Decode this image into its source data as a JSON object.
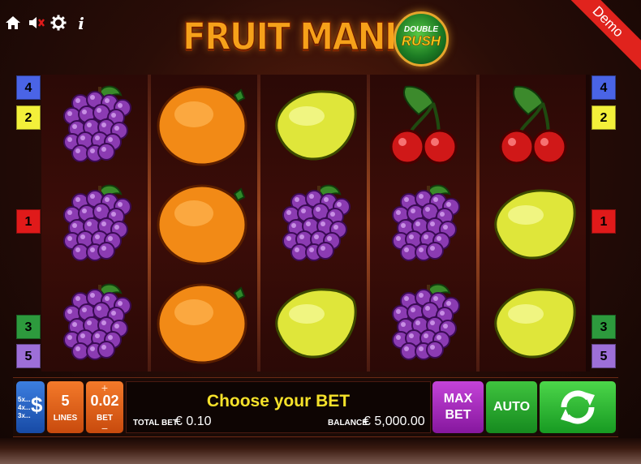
{
  "top_icons": {
    "home": "home-icon",
    "sound": "muted-speaker-icon",
    "settings": "gear-icon",
    "info": "i"
  },
  "logo": {
    "title": "FRUIT MANIA",
    "badge_top": "DOUBLE",
    "badge_bottom": "RUSH"
  },
  "demo_label": "Demo",
  "reels": [
    [
      "grapes",
      "grapes",
      "grapes"
    ],
    [
      "orange",
      "orange",
      "orange"
    ],
    [
      "lemon",
      "grapes",
      "lemon"
    ],
    [
      "cherries",
      "grapes",
      "grapes"
    ],
    [
      "cherries",
      "lemon",
      "lemon"
    ]
  ],
  "line_markers": {
    "left": [
      {
        "label": "4",
        "color": "#4a64e6"
      },
      {
        "label": "2",
        "color": "#f3f03a"
      },
      {
        "label": "1",
        "color": "#e01a1a"
      },
      {
        "label": "3",
        "color": "#2d9a3d"
      },
      {
        "label": "5",
        "color": "#9d6fd8"
      }
    ],
    "right": [
      {
        "label": "4",
        "color": "#4a64e6"
      },
      {
        "label": "2",
        "color": "#f3f03a"
      },
      {
        "label": "1",
        "color": "#e01a1a"
      },
      {
        "label": "3",
        "color": "#2d9a3d"
      },
      {
        "label": "5",
        "color": "#9d6fd8"
      }
    ]
  },
  "controls": {
    "coins_multipliers": [
      "5x...",
      "4x...",
      "3x..."
    ],
    "coins_symbol": "$",
    "lines_value": "5",
    "lines_label": "LINES",
    "bet_plus": "+",
    "bet_value": "0.02",
    "bet_label": "BET",
    "bet_minus": "−",
    "message": "Choose your BET",
    "total_bet_label": "TOTAL BET",
    "total_bet_value": "€ 0.10",
    "balance_label": "BALANCE",
    "balance_value": "€ 5,000.00",
    "max_bet_line1": "MAX",
    "max_bet_line2": "BET",
    "auto_label": "AUTO"
  }
}
